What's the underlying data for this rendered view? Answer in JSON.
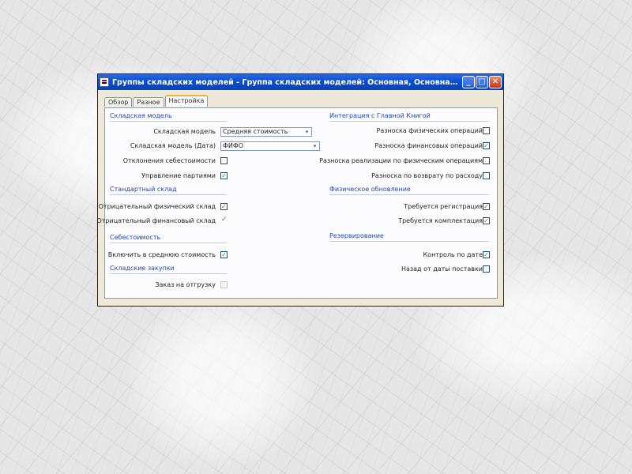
{
  "window": {
    "title": "Группы складских моделей - Группа складских моделей: Основная, Основная группа скла...",
    "buttons": {
      "minimize": "_",
      "maximize": "□",
      "close": "✕"
    }
  },
  "tabs": [
    {
      "label": "Обзор"
    },
    {
      "label": "Разное"
    },
    {
      "label": "Настройка"
    }
  ],
  "left": {
    "warehouse_model": {
      "heading": "Складская модель",
      "model_label": "Складская модель",
      "model_value": "Средняя стоимость",
      "model_btn": "▾",
      "model_date_label": "Складская модель (Дата)",
      "model_date_value": "ФИФО",
      "model_date_btn": "▾",
      "cost_label": "Отклонения себестоимости",
      "mgmt_label": "Управление партиями"
    },
    "physical_stock": {
      "heading": "Стандартный склад",
      "negative_phys_label": "Отрицательный физический склад",
      "negative_fin_label": "Отрицательный финансовый склад"
    },
    "cost": {
      "heading": "Себестоимость",
      "incl_label": "Включить в среднюю стоимость"
    },
    "ledger": {
      "heading": "Складские закупки",
      "order_label": "Заказ на отгрузку"
    }
  },
  "right": {
    "ledger_integration": {
      "heading": "Интеграция с Главной Книгой",
      "post_phys_label": "Разноска физических операций",
      "post_fin_label": "Разноска финансовых операций",
      "post_realization_label": "Разноска реализации по физическим операциям",
      "post_return_label": "Разноска по возврату по расходу"
    },
    "physical_update": {
      "heading": "Физическое обновление",
      "registration_label": "Требуется регистрация",
      "pick_label": "Требуется комплектация"
    },
    "reservation": {
      "heading": "Резервирование",
      "date_control_label": "Контроль по дате",
      "backward_label": "Назад от даты поставки"
    }
  },
  "checkmark": "✓",
  "colors": {
    "title_bar": "#0a50d5",
    "window_bg": "#ece9d8",
    "section_heading": "#1f46b8",
    "check_green": "#21a121"
  }
}
